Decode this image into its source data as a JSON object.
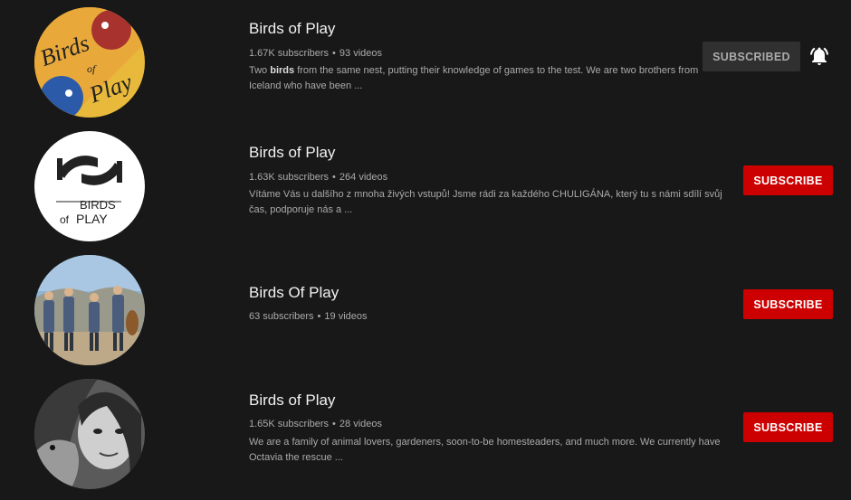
{
  "channels": [
    {
      "title": "Birds of Play",
      "subscribers": "1.67K subscribers",
      "dot": "•",
      "videos": "93 videos",
      "desc_before": "Two ",
      "desc_bold": "birds",
      "desc_after": " from the same nest, putting their knowledge of games to the test. We are two brothers from Iceland who have been ...",
      "button_label": "SUBSCRIBED",
      "avatar_text_1": "Birds",
      "avatar_text_2": "of",
      "avatar_text_3": "Play"
    },
    {
      "title": "Birds of Play",
      "subscribers": "1.63K subscribers",
      "dot": "•",
      "videos": "264 videos",
      "desc": "Vítáme Vás u dalšího z mnoha živých vstupů! Jsme rádi za každého CHULIGÁNA, který tu s námi sdílí svůj čas, podporuje nás a ...",
      "button_label": "SUBSCRIBE",
      "avatar_text_1": "BIRDS",
      "avatar_text_2": "of",
      "avatar_text_3": "PLAY"
    },
    {
      "title": "Birds Of Play",
      "subscribers": "63 subscribers",
      "dot": "•",
      "videos": "19 videos",
      "button_label": "SUBSCRIBE"
    },
    {
      "title": "Birds of Play",
      "subscribers": "1.65K subscribers",
      "dot": "•",
      "videos": "28 videos",
      "desc": "We are a family of animal lovers, gardeners, soon-to-be homesteaders, and much more. We currently have Octavia the rescue ...",
      "button_label": "SUBSCRIBE"
    }
  ],
  "colors": {
    "background": "#181818",
    "subscribe": "#cc0000",
    "subscribed": "#303030",
    "meta_text": "#aaaaaa"
  },
  "icons": {
    "notification": "bell-ringing-icon"
  }
}
